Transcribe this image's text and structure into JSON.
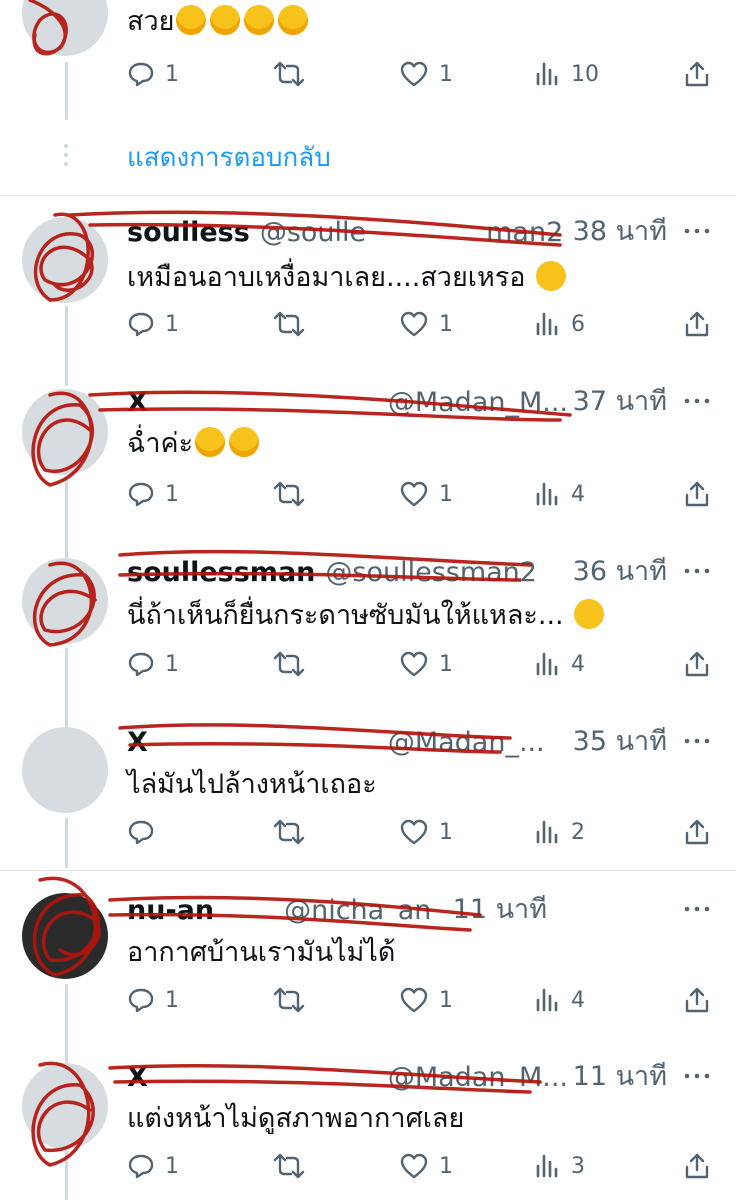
{
  "top_reply": {
    "text": "สวย",
    "emoji_count": 4,
    "actions": {
      "replies": "1",
      "likes": "1",
      "views": "10"
    }
  },
  "show_replies_label": "แสดงการตอบกลับ",
  "replies": [
    {
      "name": "soulless",
      "handle": "@soulle",
      "handle_end": "man2",
      "time": "38 นาที",
      "text": "เหมือนอาบเหงื่อมาเลย....สวยเหรอ",
      "emoji": "shock",
      "actions": {
        "replies": "1",
        "retweets": "",
        "likes": "1",
        "views": "6"
      }
    },
    {
      "name": "X",
      "handle": "@Madan_M...",
      "time": "37 นาที",
      "text": "ฉ่ำค่ะ",
      "emoji": "laugh2",
      "actions": {
        "replies": "1",
        "retweets": "",
        "likes": "1",
        "views": "4"
      }
    },
    {
      "name": "soullessman",
      "handle": "@soullessman2",
      "time": "36 นาที",
      "text": "นี่ถ้าเห็นก็ยื่นกระดาษซับมันให้แหละ...",
      "emoji": "sweat",
      "actions": {
        "replies": "1",
        "retweets": "",
        "likes": "1",
        "views": "4"
      }
    },
    {
      "name": "X",
      "handle": "@Madan_...",
      "time": "35 นาที",
      "text": "ไล่มันไปล้างหน้าเถอะ",
      "emoji": "",
      "actions": {
        "replies": "",
        "retweets": "",
        "likes": "1",
        "views": "2"
      }
    },
    {
      "name": "nu-an",
      "handle": "@nicha_an",
      "time": "11 นาที",
      "text": "อากาศบ้านเรามันไม่ได้",
      "emoji": "",
      "actions": {
        "replies": "1",
        "retweets": "",
        "likes": "1",
        "views": "4"
      }
    },
    {
      "name": "X",
      "handle": "@Madan_M...",
      "time": "11 นาที",
      "text": "แต่งหน้าไม่ดูสภาพอากาศเลย",
      "emoji": "",
      "actions": {
        "replies": "1",
        "retweets": "",
        "likes": "1",
        "views": "3"
      }
    }
  ],
  "icons": {
    "reply": "reply-icon",
    "retweet": "retweet-icon",
    "like": "like-icon",
    "views": "views-icon",
    "share": "share-icon",
    "more": "more-icon"
  },
  "colors": {
    "accent": "#1d9bf0",
    "muted": "#536471",
    "redaction": "#b3140c"
  }
}
